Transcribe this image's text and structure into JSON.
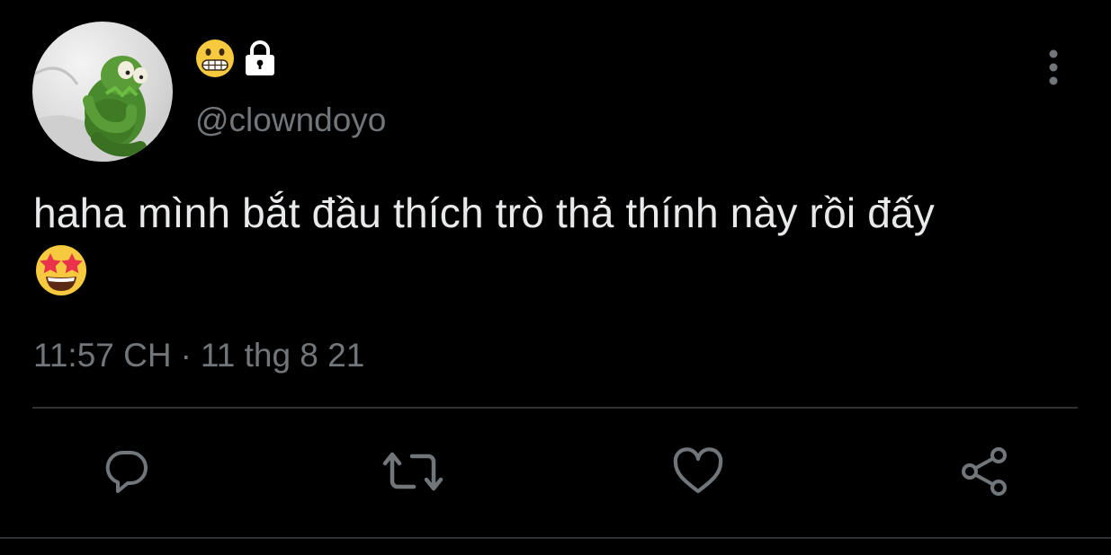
{
  "user": {
    "display_name_icon": "grimacing-face-emoji",
    "protected_icon": "lock-icon",
    "handle": "@clowndoyo",
    "avatar_icon": "avatar-kermit-image"
  },
  "tweet": {
    "text": "haha mình bắt đầu thích trò thả thính này rồi đấy",
    "trailing_emoji": "star-struck-emoji",
    "time": "11:57 CH",
    "separator": "·",
    "date": "11 thg 8 21"
  },
  "header": {
    "more_icon": "more-vertical-icon"
  },
  "actions": [
    {
      "name": "reply",
      "icon": "reply-icon"
    },
    {
      "name": "retweet",
      "icon": "retweet-icon"
    },
    {
      "name": "like",
      "icon": "heart-icon"
    },
    {
      "name": "share",
      "icon": "share-icon"
    }
  ],
  "colors": {
    "background": "#000000",
    "text": "#e7e9ea",
    "secondary_text": "#71767b",
    "divider": "#2f3336",
    "icon": "#71767b"
  }
}
